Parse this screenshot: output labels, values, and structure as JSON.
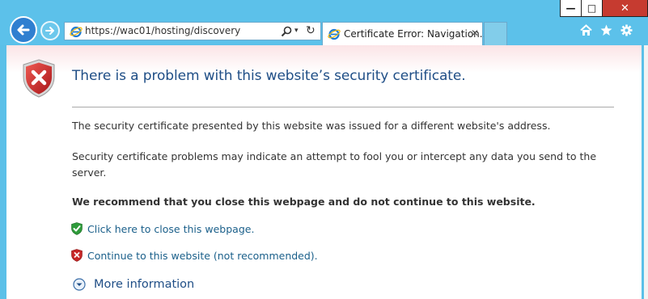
{
  "window": {
    "minimize_glyph": "—",
    "maximize_glyph": "□",
    "close_glyph": "✕"
  },
  "navigation": {
    "back_icon": "back-arrow-icon",
    "forward_icon": "forward-arrow-icon"
  },
  "address_bar": {
    "url": "https://wac01/hosting/discovery",
    "search_icon": "search-icon",
    "dropdown_glyph": "▾",
    "refresh_glyph": "↻"
  },
  "tabs": [
    {
      "label": "Certificate Error: Navigation...",
      "close_glyph": "✕",
      "active": true
    }
  ],
  "toolbar": {
    "icons": [
      "home-icon",
      "favorites-star-icon",
      "settings-gear-icon"
    ]
  },
  "page": {
    "headline": "There is a problem with this website’s security certificate.",
    "paragraph_1": "The security certificate presented by this website was issued for a different website's address.",
    "paragraph_2": "Security certificate problems may indicate an attempt to fool you or intercept any data you send to the server.",
    "recommendation": "We recommend that you close this webpage and do not continue to this website.",
    "close_link": "Click here to close this webpage.",
    "continue_link": "Continue to this website (not recommended).",
    "more_info": "More information"
  },
  "colors": {
    "chrome": "#5bc0e8",
    "headline": "#1f4e86",
    "link": "#1a5f8a",
    "error_shield": "#c62828",
    "ok_shield": "#2e9b3a",
    "close_button": "#c63b30"
  }
}
